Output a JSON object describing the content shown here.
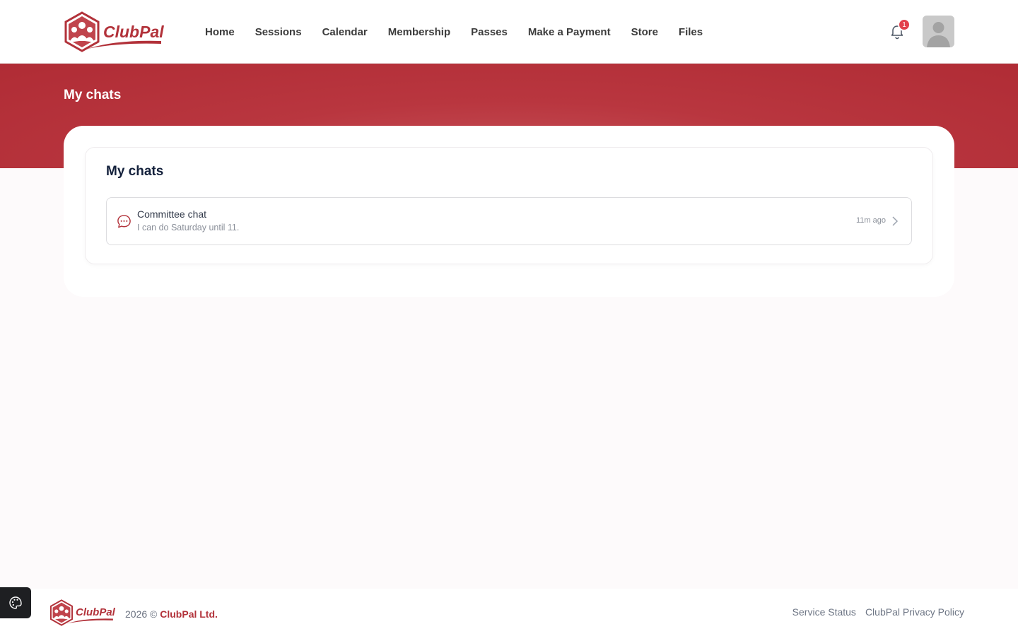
{
  "brand": {
    "name": "ClubPal",
    "primary_color": "#b2323a"
  },
  "nav": {
    "items": [
      "Home",
      "Sessions",
      "Calendar",
      "Membership",
      "Passes",
      "Make a Payment",
      "Store",
      "Files"
    ]
  },
  "header": {
    "notification_count": "1",
    "icons": [
      "bell-icon",
      "avatar"
    ]
  },
  "hero": {
    "title": "My chats"
  },
  "chats_card": {
    "title": "My chats",
    "items": [
      {
        "name": "Committee chat",
        "preview": "I can do Saturday until 11.",
        "time": "11m ago"
      }
    ]
  },
  "footer": {
    "year_text": "2026 ©",
    "company": "ClubPal Ltd.",
    "links": [
      "Service Status",
      "ClubPal Privacy Policy"
    ]
  }
}
